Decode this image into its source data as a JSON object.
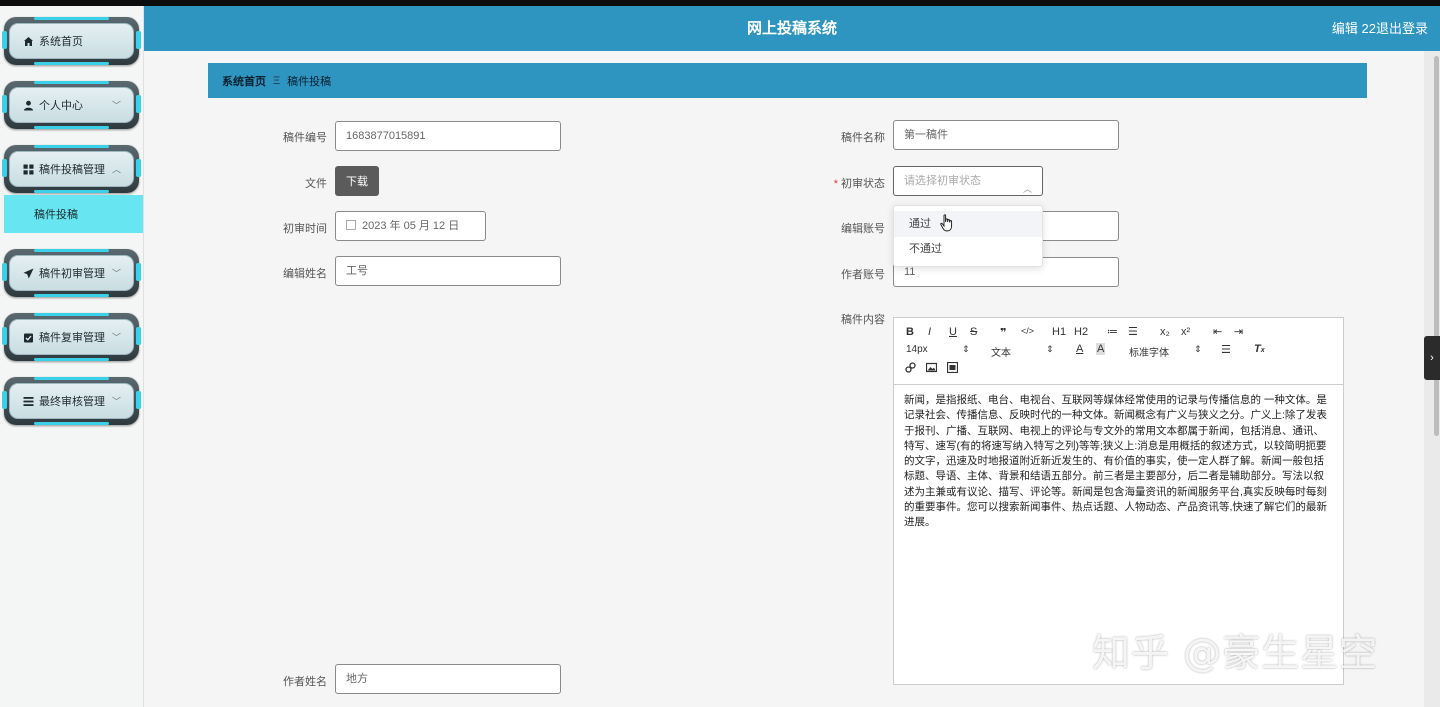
{
  "app": {
    "title": "网上投稿系统",
    "user": "编辑 22",
    "logout": "退出登录"
  },
  "sidebar": {
    "items": [
      {
        "label": "系统首页",
        "icon": "home-icon"
      },
      {
        "label": "个人中心",
        "icon": "user-icon"
      },
      {
        "label": "稿件投稿管理",
        "icon": "grid-icon"
      },
      {
        "label": "稿件初审管理",
        "icon": "send-icon"
      },
      {
        "label": "稿件复审管理",
        "icon": "clipboard-check-icon"
      },
      {
        "label": "最终审核管理",
        "icon": "list-icon"
      }
    ],
    "submenu_active": "稿件投稿"
  },
  "breadcrumb": {
    "home": "系统首页",
    "sep": "Ξ",
    "current": "稿件投稿"
  },
  "form": {
    "id_label": "稿件编号",
    "id_value": "1683877015891",
    "name_label": "稿件名称",
    "name_value": "第一稿件",
    "file_label": "文件",
    "download": "下载",
    "status_label": "初审状态",
    "status_placeholder": "请选择初审状态",
    "review_time_label": "初审时间",
    "review_time_value": "2023 年 05 月 12 日",
    "editor_account_label": "编辑账号",
    "editor_name_label": "编辑姓名",
    "editor_name_value": "工号",
    "author_account_label": "作者账号",
    "author_account_value": "11",
    "content_label": "稿件内容",
    "author_name_label": "作者姓名",
    "author_name_value": "地方"
  },
  "dropdown": {
    "options": [
      "通过",
      "不通过"
    ]
  },
  "editor": {
    "toolbar": {
      "row1": [
        "B",
        "I",
        "U",
        "S",
        "❞",
        "</>",
        "H1",
        "H2",
        "≔",
        "☰",
        "x₂",
        "x²",
        "⇤",
        "⇥"
      ],
      "size": "14px",
      "style": "文本",
      "font": "标准字体"
    },
    "content": "新闻，是指报纸、电台、电视台、互联网等媒体经常使用的记录与传播信息的 一种文体。是记录社会、传播信息、反映时代的一种文体。新闻概念有广义与狭义之分。广义上:除了发表于报刊、广播、互联网、电视上的评论与专文外的常用文本都属于新闻，包括消息、通讯、特写、速写(有的将速写纳入特写之列)等等;狭义上:消息是用概括的叙述方式，以较简明扼要的文字，迅速及时地报道附近新近发生的、有价值的事实，使一定人群了解。新闻一般包括标题、导语、主体、背景和结语五部分。前三者是主要部分，后二者是辅助部分。写法以叙述为主兼或有议论、描写、评论等。新闻是包含海量资讯的新闻服务平台,真实反映每时每刻的重要事件。您可以搜索新闻事件、热点话题、人物动态、产品资讯等,快速了解它们的最新进展。"
  },
  "watermark": "知乎 @豪生星空"
}
